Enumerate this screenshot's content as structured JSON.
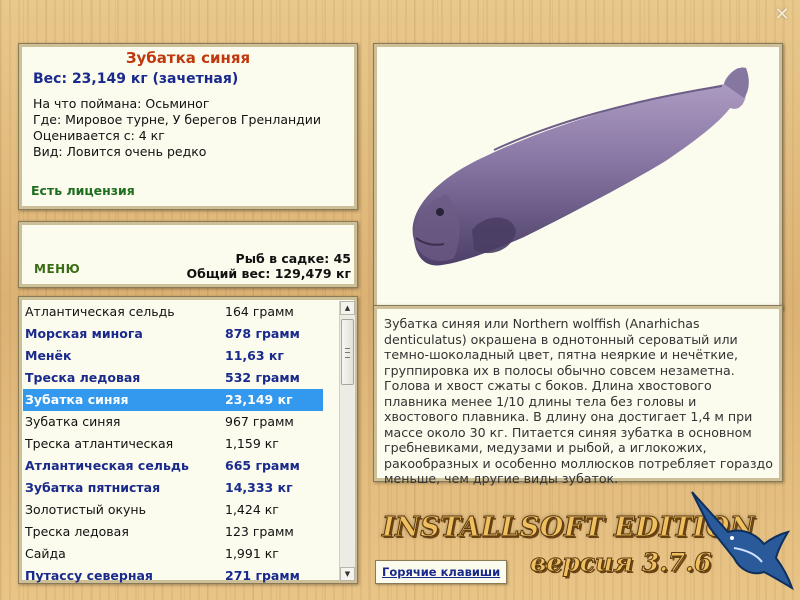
{
  "window": {
    "close_symbol": "✕"
  },
  "info": {
    "name": "Зубатка синяя",
    "weight": "Вес: 23,149 кг (зачетная)",
    "caught_on": "На что поймана: Осьминог",
    "location": "Где: Мировое турне, У берегов Гренландии",
    "rated_from": "Оценивается с: 4 кг",
    "rarity": "Вид: Ловится очень редко",
    "license": "Есть лицензия"
  },
  "stats": {
    "menu_label": "МЕНЮ",
    "fish_in_keepnet": "Рыб в садке: 45",
    "total_weight": "Общий вес: 129,479 кг"
  },
  "fish_list": [
    {
      "name": "Атлантическая сельдь",
      "weight": "164 грамм",
      "bold": false,
      "selected": false
    },
    {
      "name": "Морская минога",
      "weight": "878 грамм",
      "bold": true,
      "selected": false
    },
    {
      "name": "Менёк",
      "weight": "11,63 кг",
      "bold": true,
      "selected": false
    },
    {
      "name": "Треска ледовая",
      "weight": "532 грамм",
      "bold": true,
      "selected": false
    },
    {
      "name": "Зубатка синяя",
      "weight": "23,149 кг",
      "bold": true,
      "selected": true
    },
    {
      "name": "Зубатка синяя",
      "weight": "967 грамм",
      "bold": false,
      "selected": false
    },
    {
      "name": "Треска атлантическая",
      "weight": "1,159 кг",
      "bold": false,
      "selected": false
    },
    {
      "name": "Атлантическая сельдь",
      "weight": "665 грамм",
      "bold": true,
      "selected": false
    },
    {
      "name": "Зубатка пятнистая",
      "weight": "14,333 кг",
      "bold": true,
      "selected": false
    },
    {
      "name": "Золотистый окунь",
      "weight": "1,424 кг",
      "bold": false,
      "selected": false
    },
    {
      "name": "Треска ледовая",
      "weight": "123 грамм",
      "bold": false,
      "selected": false
    },
    {
      "name": "Сайда",
      "weight": "1,991 кг",
      "bold": false,
      "selected": false
    },
    {
      "name": "Путассу северная",
      "weight": "271 грамм",
      "bold": true,
      "selected": false
    }
  ],
  "scrollbar": {
    "up_symbol": "▲",
    "down_symbol": "▼"
  },
  "description": "Зубатка синяя или Northern wolffish (Anarhichas denticulatus) окрашена в однотонный сероватый или темно-шоколадный цвет, пятна неяркие и нечёткие, группировка их в полосы обычно совсем незаметна. Голова и хвост сжаты с боков. Длина хвостового плавника менее 1/10 длины тела без головы и хвостового плавника. В длину она достигает 1,4 м при массе около 30 кг. Питается синяя зубатка в основном гребневиками, медузами и рыбой, а иглокожих, ракообразных и особенно моллюсков потребляет гораздо меньше, чем другие виды зубаток.",
  "footer": {
    "hotkeys_label": "Горячие клавиши",
    "brand": "INSTALLSOFT EDITION",
    "version": "версия 3.7.6"
  },
  "colors": {
    "title_red": "#c0390e",
    "dark_blue": "#1a2a8c",
    "green": "#1e6e1e",
    "selection": "#3399ee",
    "fish_body": "#8a7aa4"
  },
  "icons": {
    "fish_image": "blue-wolffish-picture",
    "logo": "marlin-logo"
  }
}
